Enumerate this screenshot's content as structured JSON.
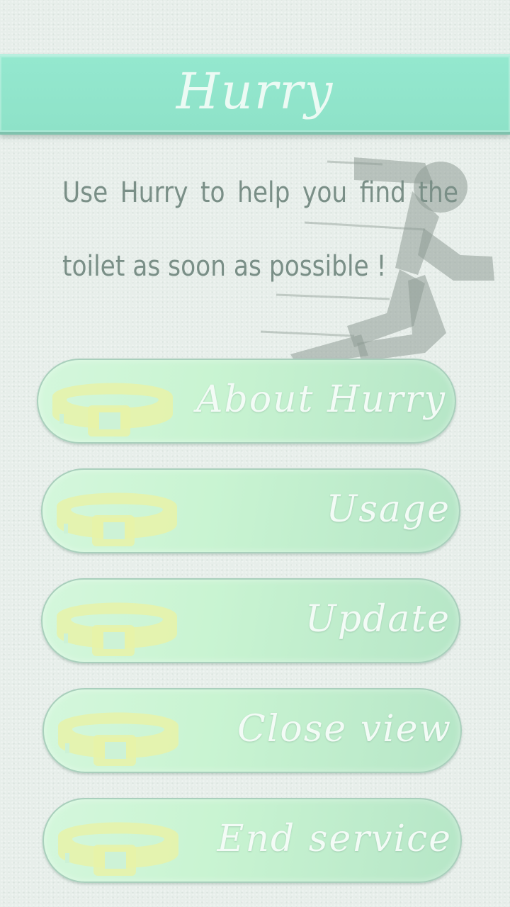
{
  "header": {
    "title": "Hurry"
  },
  "intro": {
    "text": "Use Hurry to help you find the toilet as soon as possible !"
  },
  "menu": {
    "items": [
      {
        "label": "About Hurry",
        "icon": "belt-icon"
      },
      {
        "label": "Usage",
        "icon": "belt-icon"
      },
      {
        "label": "Update",
        "icon": "belt-icon"
      },
      {
        "label": "Close view",
        "icon": "belt-icon"
      },
      {
        "label": "End service",
        "icon": "belt-icon"
      }
    ]
  },
  "colors": {
    "title_bar": "#8ee2c8",
    "button_fill": "#c9f4d2",
    "text": "#7a8f87",
    "label": "#f3fbf6"
  }
}
